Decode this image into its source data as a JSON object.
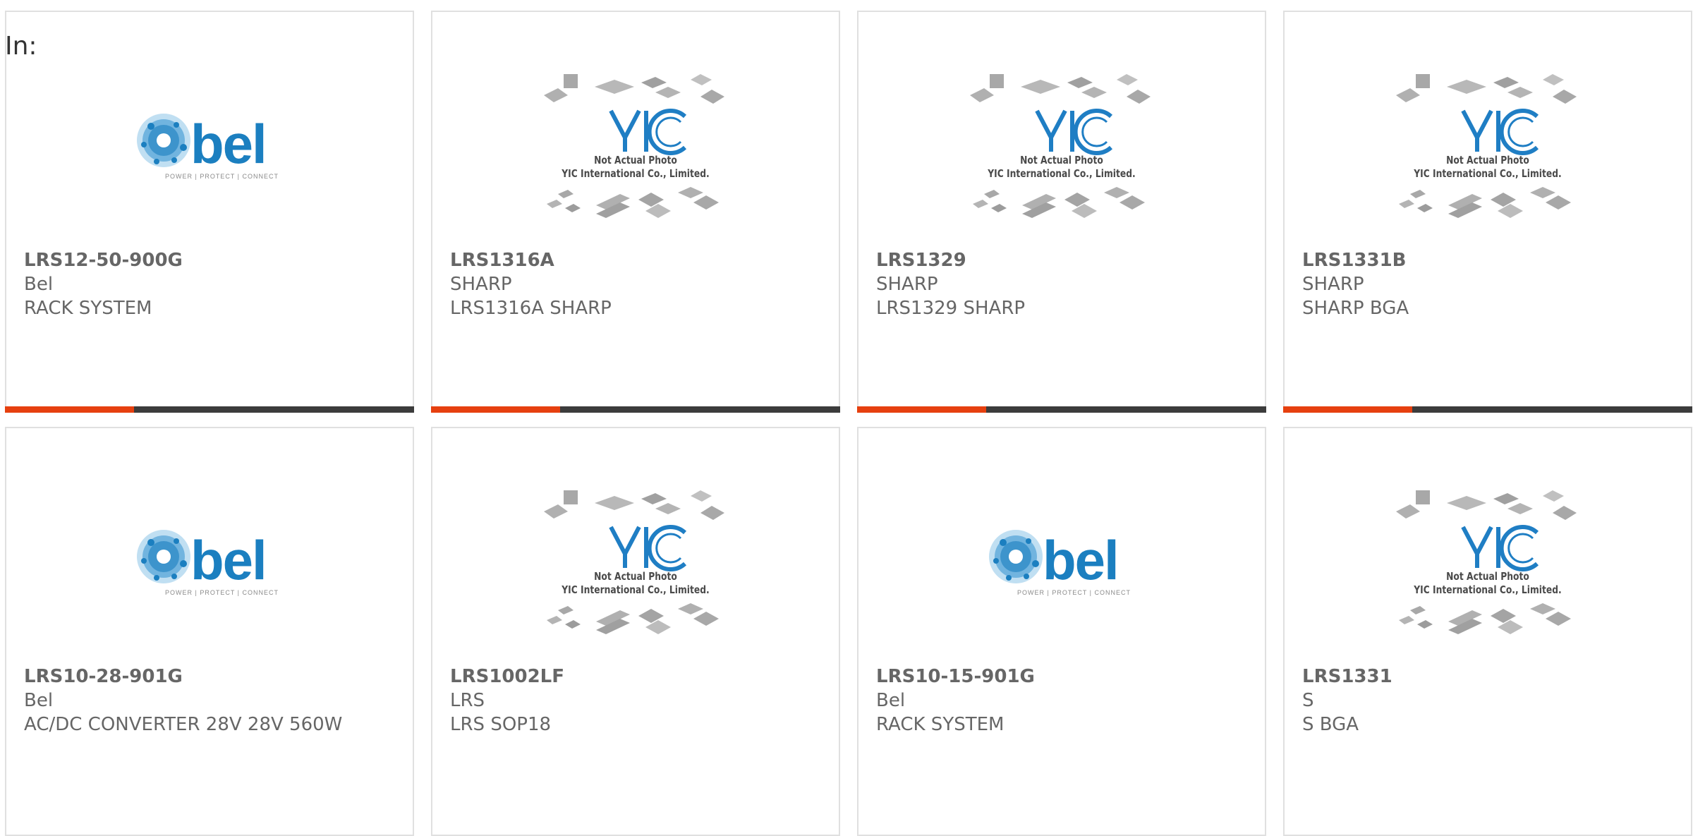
{
  "filter": {
    "label": "In:"
  },
  "products": [
    {
      "part_no": "LRS12-50-900G",
      "manufacturer": "Bel",
      "description": "RACK SYSTEM",
      "image": "bel-logo"
    },
    {
      "part_no": "LRS1316A",
      "manufacturer": "SHARP",
      "description": "LRS1316A SHARP",
      "image": "yic-placeholder"
    },
    {
      "part_no": "LRS1329",
      "manufacturer": "SHARP",
      "description": "LRS1329 SHARP",
      "image": "yic-placeholder"
    },
    {
      "part_no": "LRS1331B",
      "manufacturer": "SHARP",
      "description": "SHARP BGA",
      "image": "yic-placeholder"
    },
    {
      "part_no": "LRS10-28-901G",
      "manufacturer": "Bel",
      "description": "AC/DC CONVERTER 28V 28V 560W",
      "image": "bel-logo"
    },
    {
      "part_no": "LRS1002LF",
      "manufacturer": "LRS",
      "description": "LRS SOP18",
      "image": "yic-placeholder"
    },
    {
      "part_no": "LRS10-15-901G",
      "manufacturer": "Bel",
      "description": "RACK SYSTEM",
      "image": "bel-logo"
    },
    {
      "part_no": "LRS1331",
      "manufacturer": "S",
      "description": "S BGA",
      "image": "yic-placeholder"
    }
  ],
  "logos": {
    "bel": {
      "word": "bel",
      "tagline": "POWER | PROTECT | CONNECT"
    },
    "yic": {
      "line1": "Not Actual Photo",
      "line2": "YIC International Co., Limited."
    }
  },
  "colors": {
    "accent": "#e6400f",
    "bar": "#3c3c3c",
    "bel_blue": "#1b7fc0",
    "yic_blue": "#1f7ec4",
    "text": "#666666"
  }
}
